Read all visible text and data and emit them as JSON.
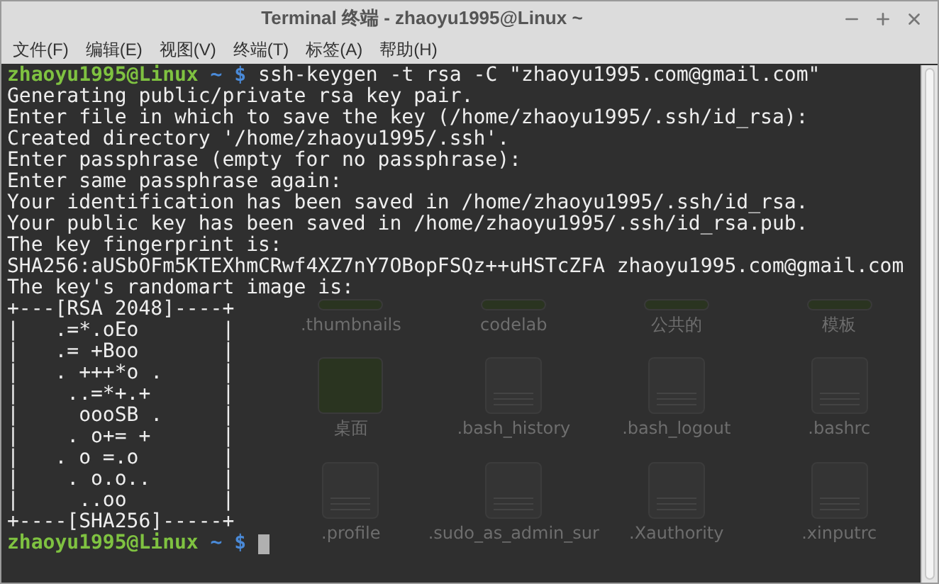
{
  "window": {
    "title": "Terminal 终端 - zhaoyu1995@Linux ~"
  },
  "menu": [
    "文件(F)",
    "编辑(E)",
    "视图(V)",
    "终端(T)",
    "标签(A)",
    "帮助(H)"
  ],
  "terminal": {
    "lines": [
      {
        "kind": "prompt",
        "user": "zhaoyu1995@Linux",
        "path": "~",
        "symbol": "$",
        "command": "ssh-keygen -t rsa -C \"zhaoyu1995.com@gmail.com\""
      },
      {
        "kind": "output",
        "text": "Generating public/private rsa key pair."
      },
      {
        "kind": "output",
        "text": "Enter file in which to save the key (/home/zhaoyu1995/.ssh/id_rsa):"
      },
      {
        "kind": "output",
        "text": "Created directory '/home/zhaoyu1995/.ssh'."
      },
      {
        "kind": "output",
        "text": "Enter passphrase (empty for no passphrase):"
      },
      {
        "kind": "output",
        "text": "Enter same passphrase again:"
      },
      {
        "kind": "output",
        "text": "Your identification has been saved in /home/zhaoyu1995/.ssh/id_rsa."
      },
      {
        "kind": "output",
        "text": "Your public key has been saved in /home/zhaoyu1995/.ssh/id_rsa.pub."
      },
      {
        "kind": "output",
        "text": "The key fingerprint is:"
      },
      {
        "kind": "output",
        "text": "SHA256:aUSbOFm5KTEXhmCRwf4XZ7nY7OBopFSQz++uHSTcZFA zhaoyu1995.com@gmail.com"
      },
      {
        "kind": "output",
        "text": "The key's randomart image is:"
      }
    ],
    "randomart": [
      {
        "kind": "output",
        "text": "+---[RSA 2048]----+"
      },
      {
        "kind": "output",
        "text": "|   .=*.oEo       |"
      },
      {
        "kind": "output",
        "text": "|   .= +Boo       |"
      },
      {
        "kind": "output",
        "text": "|   . +++*o .     |"
      },
      {
        "kind": "output",
        "text": "|    ..=*+.+      |"
      },
      {
        "kind": "output",
        "text": "|     oooSB .     |"
      },
      {
        "kind": "output",
        "text": "|    . o+= +      |"
      },
      {
        "kind": "output",
        "text": "|   . o =.o       |"
      },
      {
        "kind": "output",
        "text": "|    . o.o..      |"
      },
      {
        "kind": "output",
        "text": "|     ..oo        |"
      },
      {
        "kind": "output",
        "text": "+----[SHA256]-----+"
      },
      {
        "kind": "prompt",
        "user": "zhaoyu1995@Linux",
        "path": "~",
        "symbol": "$",
        "cursor": true
      }
    ]
  },
  "desktop_files": [
    {
      "label": ".thumbnails",
      "kind": "folder"
    },
    {
      "label": "codelab",
      "kind": "folder"
    },
    {
      "label": "公共的",
      "kind": "folder"
    },
    {
      "label": "模板",
      "kind": "folder"
    },
    {
      "label": "桌面",
      "kind": "folder"
    },
    {
      "label": ".bash_history",
      "kind": "document"
    },
    {
      "label": ".bash_logout",
      "kind": "document"
    },
    {
      "label": ".bashrc",
      "kind": "document"
    },
    {
      "label": ".profile",
      "kind": "document"
    },
    {
      "label": ".sudo_as_admin_sur",
      "kind": "document"
    },
    {
      "label": ".Xauthority",
      "kind": "document"
    },
    {
      "label": ".xinputrc",
      "kind": "document"
    }
  ]
}
